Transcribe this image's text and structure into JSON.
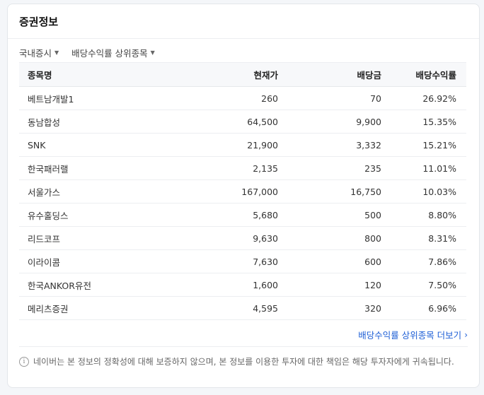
{
  "card": {
    "title": "증권정보"
  },
  "filters": {
    "market": "국내증시",
    "sort": "배당수익률 상위종목"
  },
  "table": {
    "headers": {
      "name": "종목명",
      "price": "현재가",
      "dividend": "배당금",
      "yield": "배당수익률"
    },
    "rows": [
      {
        "name": "베트남개발1",
        "price": "260",
        "dividend": "70",
        "yield": "26.92%"
      },
      {
        "name": "동남합성",
        "price": "64,500",
        "dividend": "9,900",
        "yield": "15.35%"
      },
      {
        "name": "SNK",
        "price": "21,900",
        "dividend": "3,332",
        "yield": "15.21%"
      },
      {
        "name": "한국패러랠",
        "price": "2,135",
        "dividend": "235",
        "yield": "11.01%"
      },
      {
        "name": "서울가스",
        "price": "167,000",
        "dividend": "16,750",
        "yield": "10.03%"
      },
      {
        "name": "유수홀딩스",
        "price": "5,680",
        "dividend": "500",
        "yield": "8.80%"
      },
      {
        "name": "리드코프",
        "price": "9,630",
        "dividend": "800",
        "yield": "8.31%"
      },
      {
        "name": "이라이콤",
        "price": "7,630",
        "dividend": "600",
        "yield": "7.86%"
      },
      {
        "name": "한국ANKOR유전",
        "price": "1,600",
        "dividend": "120",
        "yield": "7.50%"
      },
      {
        "name": "메리츠증권",
        "price": "4,595",
        "dividend": "320",
        "yield": "6.96%"
      }
    ]
  },
  "more_link": "배당수익률 상위종목 더보기",
  "disclaimer": "네이버는 본 정보의 정확성에 대해 보증하지 않으며, 본 정보를 이용한 투자에 대한 책임은 해당 투자자에게 귀속됩니다.",
  "icons": {
    "caret": "caret-down-icon",
    "chevron": "chevron-right-icon",
    "info": "info-icon"
  },
  "colors": {
    "link": "#1e5fd6",
    "header_bg": "#f7f8fa"
  }
}
